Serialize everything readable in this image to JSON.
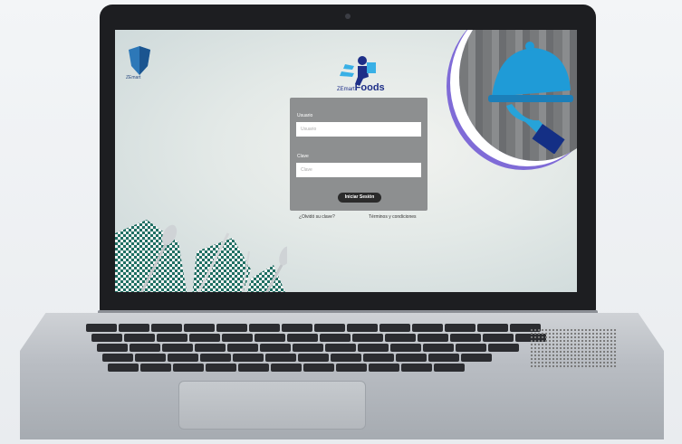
{
  "top_left_logo": {
    "text": "ZEmart"
  },
  "brand": {
    "prefix": "ZEmart",
    "name": "Foods"
  },
  "login": {
    "username_label": "Usuario",
    "username_placeholder": "Usuario",
    "password_label": "Clave",
    "password_placeholder": "Clave",
    "submit_label": "Iniciar Sesión"
  },
  "links": {
    "forgot": "¿Olvidó su clave?",
    "terms": "Términos y condiciones"
  }
}
